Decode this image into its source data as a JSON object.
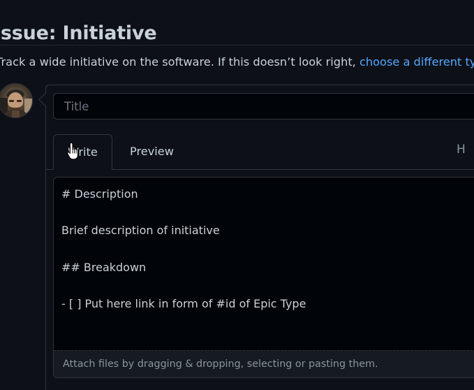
{
  "header": {
    "title": "Issue: Initiative"
  },
  "template_info": {
    "text": "Track a wide initiative on the software. If this doesn’t look right, ",
    "link": "choose a different type."
  },
  "user": {
    "avatar_icon": "user-avatar-icon"
  },
  "issue_form": {
    "title_placeholder": "Title",
    "tabs": [
      {
        "label": "Write",
        "active": true
      },
      {
        "label": "Preview",
        "active": false
      }
    ],
    "toolbar": {
      "heading_button": "H"
    },
    "body_lines": [
      "# Description",
      "",
      "Brief description of initiative",
      "",
      "## Breakdown",
      "",
      "- [ ] Put here link in form of #id of Epic Type"
    ],
    "attach_text": "Attach files by dragging & dropping, selecting or pasting them."
  },
  "colors": {
    "background": "#0d1117",
    "input_background": "#010409",
    "border": "#30363d",
    "text": "#c9d1d9",
    "muted_text": "#8b949e",
    "link": "#58a6ff"
  }
}
